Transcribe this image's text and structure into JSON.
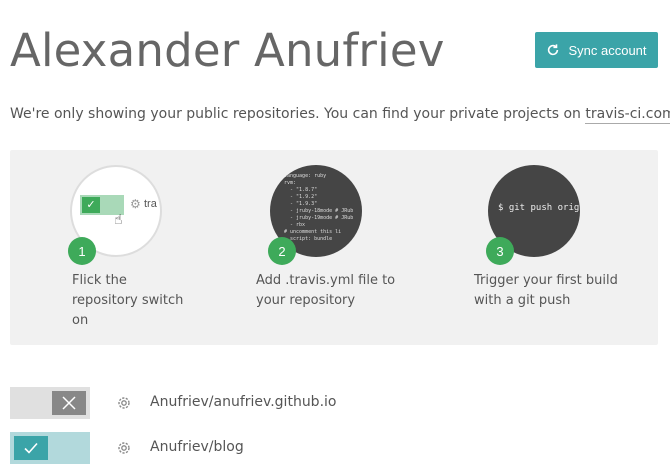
{
  "header": {
    "title": "Alexander Anufriev",
    "sync_label": "Sync account"
  },
  "notice": {
    "text": "We're only showing your public repositories. You can find your private projects on ",
    "link_text": "travis-ci.com",
    "suffix": "."
  },
  "onboarding": {
    "steps": [
      {
        "number": "1",
        "text": "Flick the repository switch on",
        "preview_text": "tra"
      },
      {
        "number": "2",
        "text": "Add .travis.yml file to your repository",
        "preview_code": "language: ruby\nrvm:\n  - \"1.8.7\"\n  - \"1.9.2\"\n  - \"1.9.3\"\n  - jruby-18mode # JRub\n  - jruby-19mode # JRub\n  - rbx\n# uncomment this li\n  script: bundle"
      },
      {
        "number": "3",
        "text": "Trigger your first build with a git push",
        "preview_cmd": "$ git push origin"
      }
    ]
  },
  "repositories": [
    {
      "name": "Anufriev/anufriev.github.io",
      "enabled": false
    },
    {
      "name": "Anufriev/blog",
      "enabled": true
    }
  ],
  "colors": {
    "accent": "#3ba4a8",
    "badge_green": "#3eaa5a"
  }
}
